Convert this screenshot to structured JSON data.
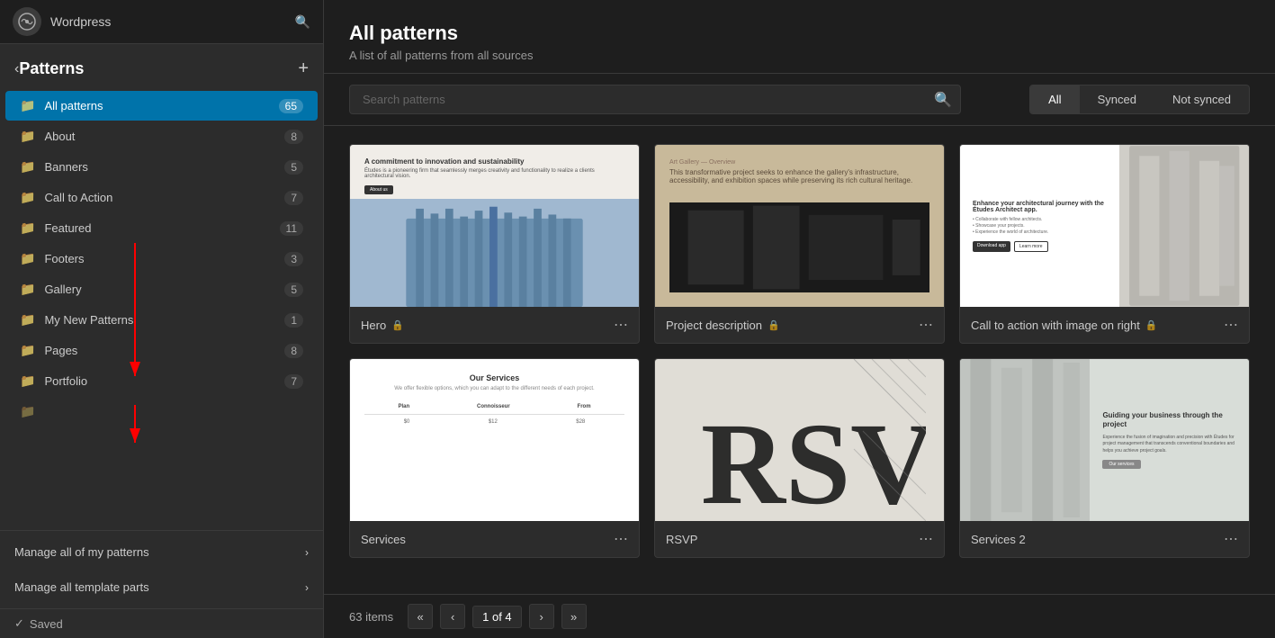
{
  "app": {
    "name": "Wordpress",
    "logo_label": "wp-logo"
  },
  "sidebar": {
    "title": "Patterns",
    "back_label": "‹",
    "add_label": "+",
    "nav_items": [
      {
        "id": "all-patterns",
        "label": "All patterns",
        "count": "65",
        "active": true
      },
      {
        "id": "about",
        "label": "About",
        "count": "8"
      },
      {
        "id": "banners",
        "label": "Banners",
        "count": "5"
      },
      {
        "id": "call-to-action",
        "label": "Call to Action",
        "count": "7"
      },
      {
        "id": "featured",
        "label": "Featured",
        "count": "11"
      },
      {
        "id": "footers",
        "label": "Footers",
        "count": "3"
      },
      {
        "id": "gallery",
        "label": "Gallery",
        "count": "5"
      },
      {
        "id": "my-new-patterns",
        "label": "My New Patterns",
        "count": "1"
      },
      {
        "id": "pages",
        "label": "Pages",
        "count": "8"
      },
      {
        "id": "portfolio",
        "label": "Portfolio",
        "count": "7"
      }
    ],
    "footer_links": [
      {
        "id": "manage-patterns",
        "label": "Manage all of my patterns"
      },
      {
        "id": "manage-template-parts",
        "label": "Manage all template parts"
      }
    ],
    "saved_label": "Saved"
  },
  "main": {
    "title": "All patterns",
    "subtitle": "A list of all patterns from all sources",
    "search_placeholder": "Search patterns",
    "filter_tabs": [
      {
        "id": "all",
        "label": "All",
        "active": true
      },
      {
        "id": "synced",
        "label": "Synced"
      },
      {
        "id": "not-synced",
        "label": "Not synced"
      }
    ],
    "patterns": [
      {
        "id": "hero",
        "name": "Hero",
        "locked": true,
        "type": "hero"
      },
      {
        "id": "project-description",
        "name": "Project description",
        "locked": true,
        "type": "project-desc"
      },
      {
        "id": "cta-right",
        "name": "Call to action with image on right",
        "locked": true,
        "type": "cta-right"
      },
      {
        "id": "services",
        "name": "Services",
        "locked": false,
        "type": "services"
      },
      {
        "id": "rsvp",
        "name": "RSVP",
        "locked": false,
        "type": "rsvp"
      },
      {
        "id": "services2",
        "name": "Services 2",
        "locked": false,
        "type": "services2"
      }
    ],
    "pagination": {
      "total": "63 items",
      "current_page": "1 of 4",
      "prev_first": "«",
      "prev": "‹",
      "next": "›",
      "next_last": "»"
    }
  }
}
